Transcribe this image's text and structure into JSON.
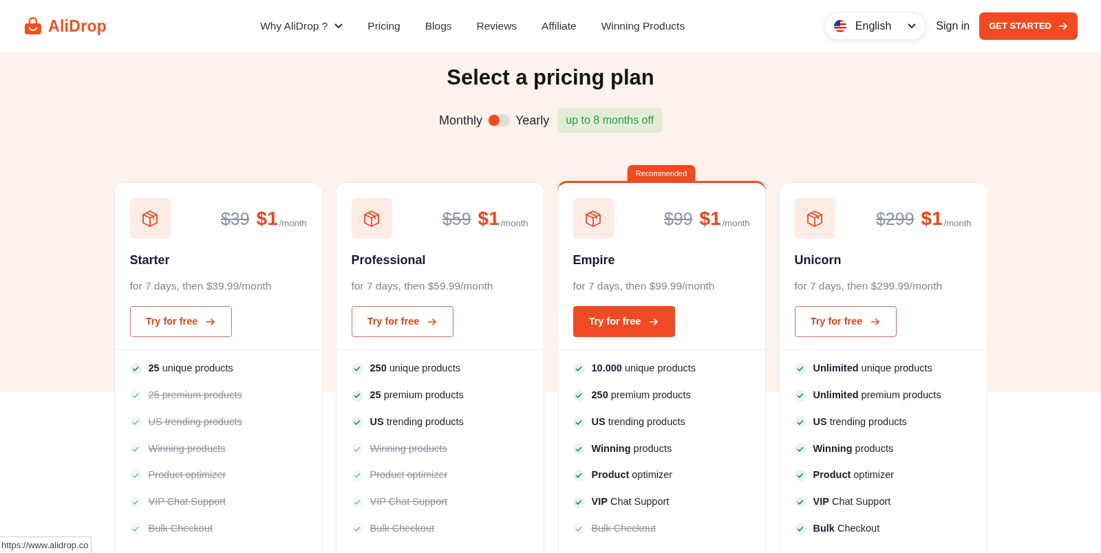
{
  "header": {
    "logo": "AliDrop",
    "nav": [
      {
        "label": "Why AliDrop ?",
        "dropdown": true
      },
      {
        "label": "Pricing",
        "dropdown": false
      },
      {
        "label": "Blogs",
        "dropdown": false
      },
      {
        "label": "Reviews",
        "dropdown": false
      },
      {
        "label": "Affiliate",
        "dropdown": false
      },
      {
        "label": "Winning Products",
        "dropdown": false
      }
    ],
    "language": "English",
    "sign_in": "Sign in",
    "cta": "GET STARTED"
  },
  "pricing": {
    "title": "Select a pricing plan",
    "billing": {
      "left_label": "Monthly",
      "right_label": "Yearly",
      "on": false,
      "badge": "up to 8 months off"
    },
    "plans": [
      {
        "name": "Starter",
        "old_price": "$39",
        "price": "$1",
        "period": "/month",
        "subtitle": "for 7 days, then $39.99/month",
        "button": "Try for free",
        "recommended": false,
        "features": [
          {
            "text": "**25** unique products",
            "included": true
          },
          {
            "text": "25 premium products",
            "included": false
          },
          {
            "text": "US trending products",
            "included": false
          },
          {
            "text": "Winning products",
            "included": false
          },
          {
            "text": "Product optimizer",
            "included": false
          },
          {
            "text": "VIP Chat Support",
            "included": false
          },
          {
            "text": "Bulk Checkout",
            "included": false
          }
        ]
      },
      {
        "name": "Professional",
        "old_price": "$59",
        "price": "$1",
        "period": "/month",
        "subtitle": "for 7 days, then $59.99/month",
        "button": "Try for free",
        "recommended": false,
        "features": [
          {
            "text": "**250** unique products",
            "included": true
          },
          {
            "text": "**25** premium products",
            "included": true
          },
          {
            "text": "**US** trending products",
            "included": true
          },
          {
            "text": "Winning products",
            "included": false
          },
          {
            "text": "Product optimizer",
            "included": false
          },
          {
            "text": "VIP Chat Support",
            "included": false
          },
          {
            "text": "Bulk Checkout",
            "included": false
          }
        ]
      },
      {
        "name": "Empire",
        "old_price": "$99",
        "price": "$1",
        "period": "/month",
        "subtitle": "for 7 days, then $99.99/month",
        "button": "Try for free",
        "recommended": true,
        "recommended_label": "Recommended",
        "features": [
          {
            "text": "**10.000** unique products",
            "included": true
          },
          {
            "text": "**250** premium products",
            "included": true
          },
          {
            "text": "**US** trending products",
            "included": true
          },
          {
            "text": "**Winning** products",
            "included": true
          },
          {
            "text": "**Product** optimizer",
            "included": true
          },
          {
            "text": "**VIP** Chat Support",
            "included": true
          },
          {
            "text": "Bulk Checkout",
            "included": false
          }
        ]
      },
      {
        "name": "Unicorn",
        "old_price": "$299",
        "price": "$1",
        "period": "/month",
        "subtitle": "for 7 days, then $299.99/month",
        "button": "Try for free",
        "recommended": false,
        "features": [
          {
            "text": "**Unlimited** unique products",
            "included": true
          },
          {
            "text": "**Unlimited** premium products",
            "included": true
          },
          {
            "text": "**US** trending products",
            "included": true
          },
          {
            "text": "**Winning** products",
            "included": true
          },
          {
            "text": "**Product** optimizer",
            "included": true
          },
          {
            "text": "**VIP** Chat Support",
            "included": true
          },
          {
            "text": "**Bulk** Checkout",
            "included": true
          }
        ]
      }
    ]
  },
  "status_bar": {
    "url": "https://www.alidrop.co"
  }
}
